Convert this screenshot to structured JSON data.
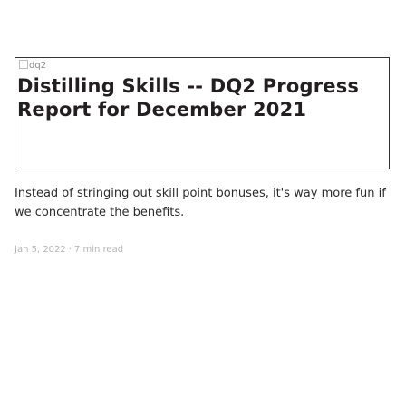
{
  "post": {
    "image_alt": "dq2",
    "title": "Distilling Skills -- DQ2 Progress Report for December 2021",
    "excerpt": "Instead of stringing out skill point bonuses, it's way more fun if we concentrate the benefits.",
    "date": "Jan 5, 2022",
    "separator": "·",
    "read_time": "7 min read"
  },
  "colors": {
    "title": "#231f20",
    "text": "#2b2b2b",
    "meta": "#b5b5b5",
    "border": "#333333"
  }
}
